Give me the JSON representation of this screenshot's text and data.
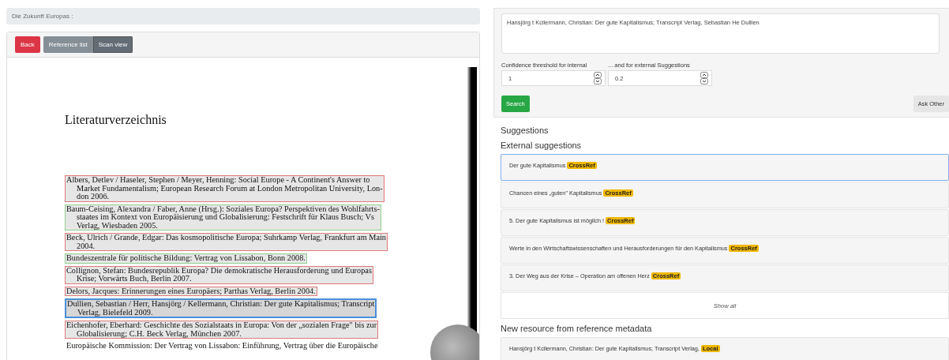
{
  "breadcrumb": "Die Zukunft Europas :",
  "back_button": "Back",
  "view_tabs": [
    {
      "label": "Reference list",
      "selected": false
    },
    {
      "label": "Scan view",
      "selected": true
    }
  ],
  "scan": {
    "heading": "Literaturverzeichnis",
    "entries": [
      {
        "lines": [
          "Albers, Detlev / Haseler, Stephen / Meyer, Henning: Social Europe - A Continent's Answer to",
          "Market Fundamentalism; European Research Forum at London Metropolitan University, Lon-",
          "don 2006."
        ],
        "color": "#e07a7a",
        "selected": false
      },
      {
        "lines": [
          "Baum-Ceising, Alexandra / Faber, Anne (Hrsg.): Soziales Europa? Perspektiven des Wohlfahrts-",
          "staates im Kontext von Europäisierung und Globalisierung: Festschrift für Klaus Busch; Vs",
          "Verlag, Wiesbaden 2005."
        ],
        "color": "#8fd08f",
        "selected": false
      },
      {
        "lines": [
          "Beck, Ulrich / Grande, Edgar: Das kosmopolitische Europa; Suhrkamp Verlag, Frankfurt am Main",
          "2004."
        ],
        "color": "#e07a7a",
        "selected": false
      },
      {
        "lines": [
          "Bundeszentrale für politische Bildung: Vertrag von Lissabon, Bonn 2008."
        ],
        "color": "#8fd08f",
        "selected": false
      },
      {
        "lines": [
          "Collignon, Stefan: Bundesrepublik Europa? Die demokratische Herausforderung und Europas",
          "Krise; Vorwärts Buch, Berlin 2007."
        ],
        "color": "#e07a7a",
        "selected": false
      },
      {
        "lines": [
          "Delors, Jacques: Erinnerungen eines Europäers; Parthas Verlag, Berlin 2004."
        ],
        "color": "#e07a7a",
        "selected": false
      },
      {
        "lines": [
          "Dullien, Sebastian / Herr, Hansjörg / Kellermann, Christian: Der gute Kapitalismus; Transcript",
          "Verlag, Bielefeld 2009."
        ],
        "color": "#4a8fd8",
        "selected": true
      },
      {
        "lines": [
          "Eichenhofer, Eberhard: Geschichte des Sozialstaats in Europa: Von der „sozialen Frage\" bis zur",
          "Globalisierung; C.H. Beck Verlag, München 2007."
        ],
        "color": "#e07a7a",
        "selected": false
      },
      {
        "lines": [
          "Europäische Kommission: Der Vertrag von Lissabon: Einführung, Vertrag über die Europäische"
        ],
        "selected": false
      }
    ]
  },
  "query": {
    "value": "Hansjörg t Kcllermann, Christian: Der gute Kapitalismus; Transcript Verlag, Sebastian He Dullien"
  },
  "thresholds": [
    {
      "label": "Confidence threshold for internal",
      "value": "1"
    },
    {
      "label": "... and for external Suggestions",
      "value": "0.2"
    }
  ],
  "search_button": "Search",
  "ask_button": "Ask Other",
  "suggestions_heading": "Suggestions",
  "external_heading": "External suggestions",
  "external": [
    {
      "title": "Der gute Kapitalismus",
      "source": "CrossRef",
      "selected": true
    },
    {
      "title": "Chancen eines „guten\" Kapitalismus",
      "source": "CrossRef",
      "selected": false
    },
    {
      "title": "5. Der gute Kapitalismus ist möglich !",
      "source": "CrossRef",
      "selected": false
    },
    {
      "title": "Werte in den Wirtschaftswissenschaften und Herausforderungen für den Kapitalismus",
      "source": "CrossRef",
      "selected": false
    },
    {
      "title": "3. Der Weg aus der Krise – Operation am offenen Herz",
      "source": "CrossRef",
      "selected": false
    }
  ],
  "show_all": "Show all",
  "new_heading": "New resource from reference metadata",
  "new": [
    {
      "title": "Hansjörg t Kcllermann, Christian: Der gute Kapitalismus; Transcript Verlag,",
      "source": "Local"
    }
  ]
}
